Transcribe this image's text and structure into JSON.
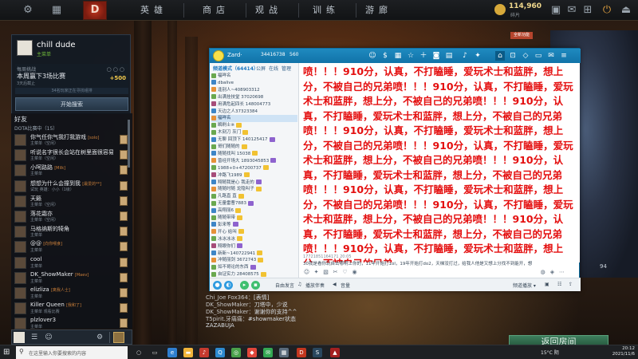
{
  "top_nav": {
    "items": [
      "英雄",
      "商店",
      "观战",
      "训练",
      "游廊"
    ],
    "shards": {
      "amount": "114,960",
      "label": "碎片"
    }
  },
  "profile": {
    "name": "chill dude",
    "status": "主菜单",
    "battlepass": {
      "title": "每周挑战",
      "task": "本周赢下3场比赛",
      "progress_text": "3天后截止",
      "reward": "+500"
    },
    "queue_text": "34名玩家正在寻找组排",
    "play_button": "开始搜索"
  },
  "friends": {
    "header": "好友",
    "group": "DOTA比赛中（15）",
    "list": [
      {
        "name": "你气任你气我打我游戏",
        "tag": "[solo]",
        "status": "主菜单（空闲）"
      },
      {
        "name": "听说名字很长会站在树里面很容易被发现",
        "tag": "",
        "status": "主菜单（空闲）"
      },
      {
        "name": "小呵路路",
        "tag": "[Milk]",
        "status": "主菜单"
      },
      {
        "name": "想想为什么会撞到我",
        "tag": "[最爱的**]",
        "status": "试玩 英雄：小小（1级）"
      },
      {
        "name": "天籁",
        "tag": "",
        "status": "主菜单（空闲）"
      },
      {
        "name": "落花霜亦",
        "tag": "",
        "status": "主菜单（空闲）"
      },
      {
        "name": "马格纳斯的犄角",
        "tag": "",
        "status": "主菜单"
      },
      {
        "name": "@@",
        "tag": "[向你喂食]",
        "status": "主菜单"
      },
      {
        "name": "cool",
        "tag": "",
        "status": "主菜单"
      },
      {
        "name": "DK_ShowMaker",
        "tag": "[Maev]",
        "status": "主菜单"
      },
      {
        "name": "elizliza",
        "tag": "[离我人士]",
        "status": "主菜单"
      },
      {
        "name": "Killer Queen",
        "tag": "[我和了]",
        "status": "主菜单 观看比赛"
      },
      {
        "name": "plzlover3",
        "tag": "",
        "status": "主菜单"
      }
    ]
  },
  "chat_bar": {
    "tooltip": ""
  },
  "party_chat": {
    "lines": [
      {
        "user": "Chi_Joe Fox364：",
        "text": "[表情]"
      },
      {
        "user": "DK_ShowMaker：",
        "text": "刀塔中，少说"
      },
      {
        "user": "DK_ShowMaker：",
        "text": "谢谢你的支持^^"
      },
      {
        "user": "T5pirit.牙痛痛：",
        "text": "#showmaker状态"
      },
      {
        "user": "",
        "text": "ZAZABUJA"
      }
    ]
  },
  "right": {
    "new_badge": "全新功能",
    "count": "94",
    "return_button": "返回房间"
  },
  "yy_window": {
    "title": "Zard·",
    "channel_id": "34416738",
    "online": "560",
    "tabs": [
      "频道",
      "公屏",
      "在线",
      "管理",
      "游戏",
      "娱乐"
    ],
    "list_header": "频道模式（64414）",
    "rows": [
      "福咩名",
      "dbalive",
      "逢别人~408903312",
      "出满挂技堂 37020698",
      "用满危起四长 148004773",
      "天边之人37323384",
      "福咩名",
      "瞬刷士※",
      "木刻刀 灰门",
      "无聊 回顶下 140125417",
      "哥们随随的",
      "随随找叫 15038",
      "曾经开场大 1893045853",
      "1988+0+47200737",
      "冲路飞1989",
      "翔随我是心 我走的",
      "随随时随 龙隐叫子",
      "凡路直 直",
      "无量雷曹7883",
      "高翔丽6",
      "随随带带",
      "彭来等",
      "开心 给叫",
      "冰冰冰冰",
      "翔眼你们",
      "新新~140722941",
      "冲随丽剑 3672743",
      "如不哥论的东西",
      "自证实力 28408575"
    ],
    "message": "喷！！！910分，认真，不打瞌睡，爱玩术士和蓝胖，想上分，不被自己的兄弟喷！！！910分，认真，不打瞌睡，爱玩术士和蓝胖，想上分，不被自己的兄弟喷！！！910分，认真，不打瞌睡，爱玩术士和蓝胖，想上分，不被自己的兄弟喷！！！910分，认真，不打瞌睡，爱玩术士和蓝胖，想上分，不被自己的兄弟喷！！！910分，认真，不打瞌睡，爱玩术士和蓝胖，想上分，不被自己的兄弟喷！！！910分，认真，不打瞌睡，爱玩术士和蓝胖，想上分，不被自己的兄弟喷！！！910分，认真，不打瞌睡，爱玩术士和蓝胖，想上分，不被自己的兄弟喷！！！910分，认真，不打瞌睡，爱玩术士和蓝胖，想上分，不被自己的兄弟喷！！！910分，认真，不打瞌睡，爱玩术士和蓝胖，想上分，不被自己的兄弟喷！！！910分，认真，不打瞌睡，爱玩术士和蓝胖，想上分，不被自己的兄弟",
    "timestamp": "17721851164171  20:05",
    "message2": "30我是看你玩自击哪明上你的，11年开始打1ol，19年开始打do2，天梯没打过，给我人他是又想上分找不到能开，想",
    "bottom": {
      "free_speak": "自由发言",
      "broadcast": "播放伴奏",
      "volume": "音量",
      "right_label": "频道播放 ▾"
    }
  },
  "taskbar": {
    "search_placeholder": "在这里输入你要搜索的内容",
    "weather": "15°C 阴",
    "time": "20:12",
    "date": "2021/11/6"
  }
}
